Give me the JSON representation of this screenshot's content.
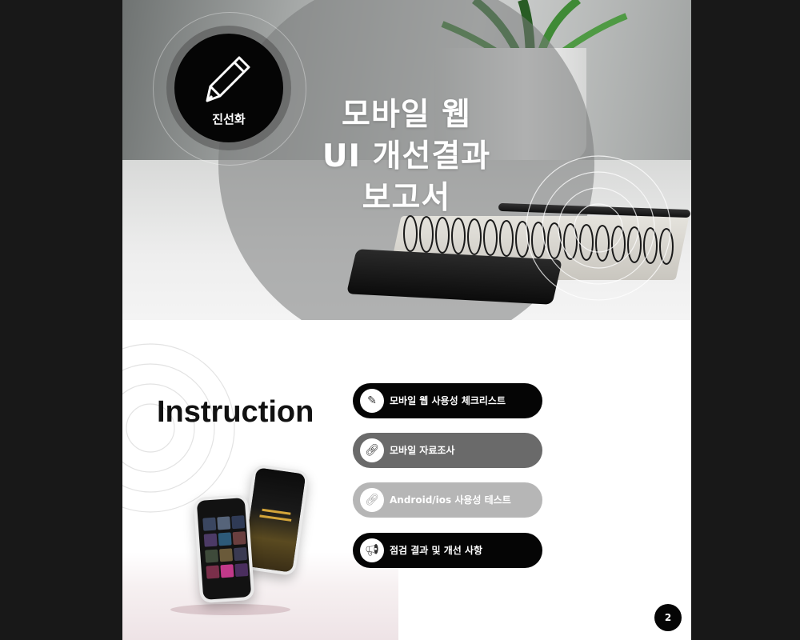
{
  "badge": {
    "name": "진선화",
    "icon": "pencil-icon"
  },
  "title": {
    "lines": [
      "모바일 웹",
      "UI 개선결과",
      "보고서"
    ]
  },
  "instruction": {
    "heading": "Instruction"
  },
  "menu": [
    {
      "label": "모바일 웹 사용성 체크리스트",
      "icon": "pencil-icon",
      "color": "#050505"
    },
    {
      "label": "모바일 자료조사",
      "icon": "link-icon",
      "color": "#6a6a6a"
    },
    {
      "label": "Android/ios 사용성 테스트",
      "icon": "link-icon",
      "color": "#b6b6b6"
    },
    {
      "label": "점검 결과 및 개선 사항",
      "icon": "megaphone-icon",
      "color": "#050505"
    }
  ],
  "page_number": "2",
  "colors": {
    "page_background": "#181818",
    "accent": "#050505"
  }
}
